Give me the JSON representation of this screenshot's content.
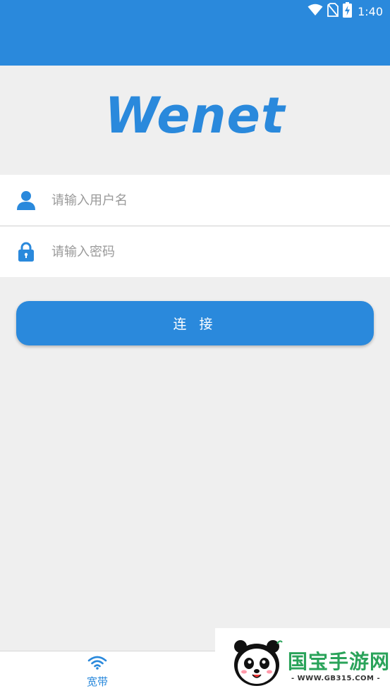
{
  "status_bar": {
    "time": "1:40",
    "icons": [
      "wifi-icon",
      "no-sim-icon",
      "battery-charging-icon"
    ]
  },
  "app": {
    "logo_text": "Wenet"
  },
  "login_form": {
    "username_placeholder": "请输入用户名",
    "password_placeholder": "请输入密码",
    "connect_label": "连 接",
    "icons": [
      "user-icon",
      "lock-icon"
    ]
  },
  "tab_bar": {
    "tabs": [
      {
        "label": "宽带",
        "icon": "wifi-icon",
        "active": true
      }
    ]
  },
  "watermark": {
    "title": "国宝手游网",
    "subtitle": "- WWW.GB315.COM -"
  },
  "colors": {
    "accent": "#2a89dc",
    "background": "#efefef",
    "watermark_green": "#2aa35a"
  }
}
